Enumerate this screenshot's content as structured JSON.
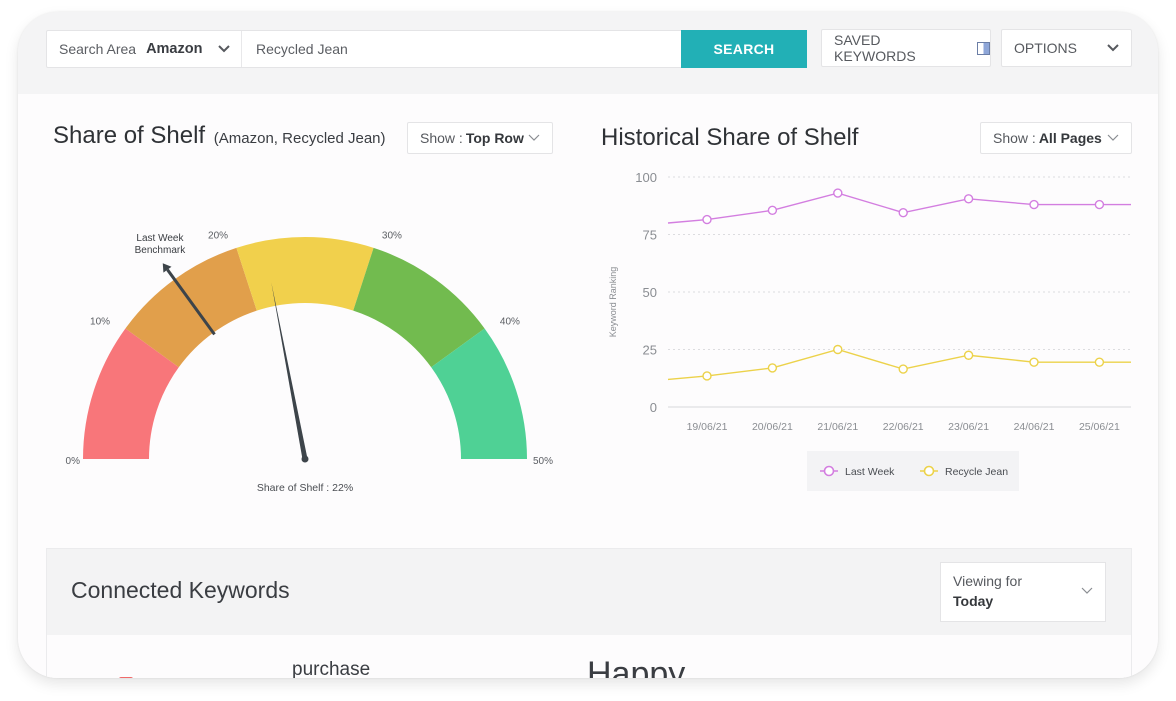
{
  "search": {
    "area_label": "Search Area",
    "area_value": "Amazon",
    "query_value": "Recycled Jean",
    "search_button": "SEARCH",
    "alert_icon": "bell-plus-icon"
  },
  "toolbar": {
    "saved_keywords": "SAVED KEYWORDS",
    "saved_icon": "panel-icon",
    "options": "OPTIONS"
  },
  "share_of_shelf": {
    "title": "Share of Shelf",
    "subtitle": "(Amazon, Recycled Jean)",
    "show_label": "Show :",
    "show_value": "Top Row"
  },
  "historical": {
    "title": "Historical Share of Shelf",
    "show_label": "Show :",
    "show_value": "All Pages"
  },
  "connected_keywords": {
    "title": "Connected Keywords",
    "viewing_label": "Viewing for",
    "viewing_value": "Today",
    "keywords": [
      "purchase",
      "Happy"
    ]
  },
  "colors": {
    "accent": "#22b0b6",
    "last_week": "#d37ee0",
    "recycle_jean": "#ecd24a"
  },
  "chart_data": [
    {
      "type": "gauge",
      "title": "Share of Shelf",
      "value": 22,
      "value_label": "Share of Shelf : 22%",
      "benchmark": 15,
      "benchmark_label": [
        "Last Week",
        "Benchmark"
      ],
      "range": [
        0,
        50
      ],
      "tick_labels": [
        "0%",
        "10%",
        "20%",
        "30%",
        "40%",
        "50%"
      ],
      "bands": [
        {
          "from": 0,
          "to": 10,
          "color": "#f8767a"
        },
        {
          "from": 10,
          "to": 20,
          "color": "#e19f4b"
        },
        {
          "from": 20,
          "to": 30,
          "color": "#f1d04c"
        },
        {
          "from": 30,
          "to": 40,
          "color": "#72bb4f"
        },
        {
          "from": 40,
          "to": 50,
          "color": "#4fd195"
        }
      ]
    },
    {
      "type": "line",
      "title": "Historical Share of Shelf",
      "xlabel": "",
      "ylabel": "Keyword Ranking",
      "ylim": [
        0,
        100
      ],
      "yticks": [
        0,
        25,
        50,
        75,
        100
      ],
      "grid": true,
      "legend": "bottom",
      "categories": [
        "19/06/21",
        "20/06/21",
        "21/06/21",
        "22/06/21",
        "23/06/21",
        "24/06/21",
        "25/06/21"
      ],
      "series": [
        {
          "name": "Last Week",
          "color": "#d37ee0",
          "start": 80,
          "end": 88,
          "values": [
            81.5,
            85.5,
            93,
            84.5,
            90.5,
            88,
            88
          ]
        },
        {
          "name": "Recycle Jean",
          "color": "#ecd24a",
          "start": 12,
          "end": 19.5,
          "values": [
            13.5,
            17,
            25,
            16.5,
            22.5,
            19.5,
            19.5
          ]
        }
      ]
    }
  ]
}
